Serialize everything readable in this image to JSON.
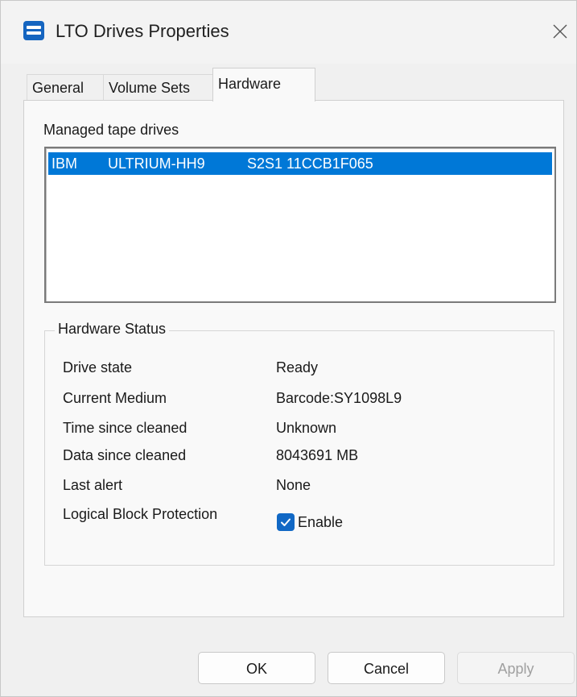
{
  "window": {
    "title": "LTO Drives Properties",
    "app_icon": "tape-drive-icon",
    "close_icon": "close-icon"
  },
  "tabs": [
    {
      "label": "General",
      "active": false
    },
    {
      "label": "Volume Sets",
      "active": false
    },
    {
      "label": "Hardware",
      "active": true
    }
  ],
  "managed": {
    "label": "Managed tape drives",
    "drives": [
      {
        "vendor": "IBM",
        "product": "ULTRIUM-HH9",
        "serial": "S2S1 11CCB1F065",
        "selected": true
      }
    ]
  },
  "hardware_status": {
    "title": "Hardware Status",
    "rows": [
      {
        "label": "Drive state",
        "value": "Ready"
      },
      {
        "label": "Current Medium",
        "value": "Barcode:SY1098L9"
      },
      {
        "label": "Time since cleaned",
        "value": "Unknown"
      },
      {
        "label": "Data since cleaned",
        "value": "8043691 MB"
      },
      {
        "label": "Last alert",
        "value": "None"
      }
    ],
    "lbp": {
      "label": "Logical Block Protection",
      "checkbox_label": "Enable",
      "checked": true
    }
  },
  "buttons": {
    "ok": "OK",
    "cancel": "Cancel",
    "apply": "Apply"
  },
  "colors": {
    "selection": "#0078d7",
    "checkbox": "#1168c5"
  }
}
